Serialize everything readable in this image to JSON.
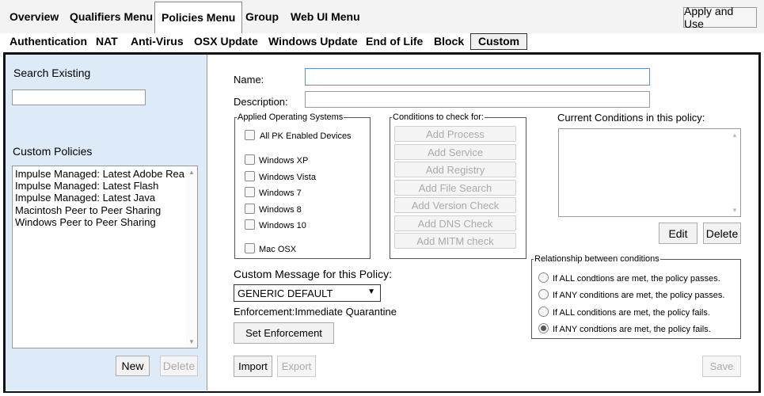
{
  "top_menu": {
    "items": [
      "Overview",
      "Qualifiers Menu",
      "Policies Menu",
      "Group",
      "Web UI Menu"
    ],
    "active": "Policies Menu",
    "apply_button": "Apply and Use"
  },
  "sub_menu": {
    "items": [
      "Authentication",
      "NAT",
      "Anti-Virus",
      "OSX Update",
      "Windows Update",
      "End of Life",
      "Block",
      "Custom"
    ],
    "active": "Custom"
  },
  "left_panel": {
    "search_label": "Search Existing",
    "search_value": "",
    "custom_policies_label": "Custom Policies",
    "policies": [
      "Impulse Managed: Latest Adobe Rea",
      "Impulse Managed: Latest Flash",
      "Impulse Managed: Latest Java",
      "Macintosh Peer to Peer Sharing",
      "Windows Peer to Peer Sharing"
    ],
    "new_button": "New",
    "delete_button": "Delete"
  },
  "form": {
    "name_label": "Name:",
    "name_value": "",
    "description_label": "Description:",
    "description_value": ""
  },
  "applied_os": {
    "legend": "Applied Operating Systems",
    "options": [
      "All PK Enabled Devices",
      "Windows XP",
      "Windows Vista",
      "Windows 7",
      "Windows 8",
      "Windows 10",
      "Mac OSX"
    ]
  },
  "conditions": {
    "legend": "Conditions to check for:",
    "buttons": [
      "Add Process",
      "Add Service",
      "Add Registry",
      "Add File Search",
      "Add Version Check",
      "Add DNS Check",
      "Add MITM check"
    ]
  },
  "current_conditions": {
    "label": "Current Conditions in this policy:",
    "edit_button": "Edit",
    "delete_button": "Delete"
  },
  "custom_message": {
    "label": "Custom Message for this Policy:",
    "selected": "GENERIC DEFAULT"
  },
  "enforcement": {
    "text": "Enforcement:Immediate Quarantine",
    "set_button": "Set Enforcement"
  },
  "relationship": {
    "legend": "Relationship between conditions",
    "options": [
      "If ALL condtions are met, the policy passes.",
      "If ANY conditions are met, the policy passes.",
      "If ALL conditions are met, the policy fails.",
      "If ANY condtions are met, the policy fails."
    ],
    "selected_index": 3
  },
  "footer": {
    "import_button": "Import",
    "export_button": "Export",
    "save_button": "Save"
  }
}
